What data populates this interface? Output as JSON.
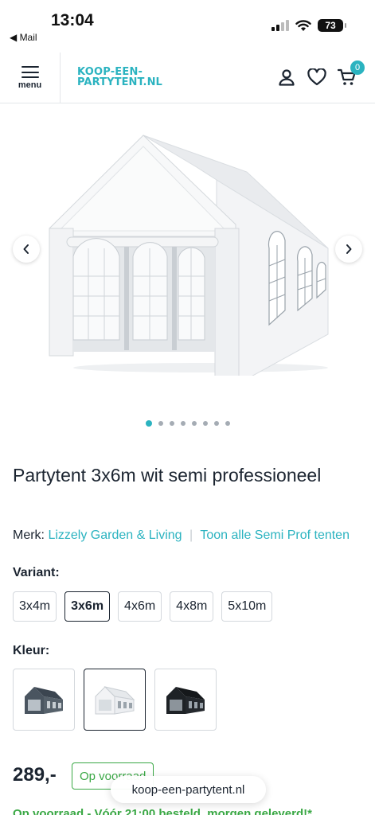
{
  "status_bar": {
    "time": "13:04",
    "back_app": "Mail",
    "battery": "73"
  },
  "header": {
    "menu_label": "menu",
    "logo_line1": "KOOP-EEN-",
    "logo_line2": "PARTYTENT.NL",
    "cart_count": "0",
    "accent_color": "#2bb3c0"
  },
  "gallery": {
    "image": "white-party-tent-3x6m",
    "dot_count": 8,
    "active_index": 0
  },
  "product": {
    "title": "Partytent 3x6m wit semi professioneel",
    "brand_prefix": "Merk:",
    "brand_name": "Lizzely Garden & Living",
    "brand_separator": "|",
    "brand_link": "Toon alle Semi Prof tenten",
    "variant_label": "Variant:",
    "variants": [
      "3x4m",
      "3x6m",
      "4x6m",
      "4x8m",
      "5x10m"
    ],
    "selected_variant": "3x6m",
    "color_label": "Kleur:",
    "colors": [
      "grey",
      "white",
      "black"
    ],
    "selected_color": "white",
    "price": "289,-",
    "stock_label": "Op voorraad",
    "delivery_text": "Op voorraad - Vóór 21:00 besteld, morgen geleverd!*"
  },
  "browser": {
    "url": "koop-een-partytent.nl"
  }
}
